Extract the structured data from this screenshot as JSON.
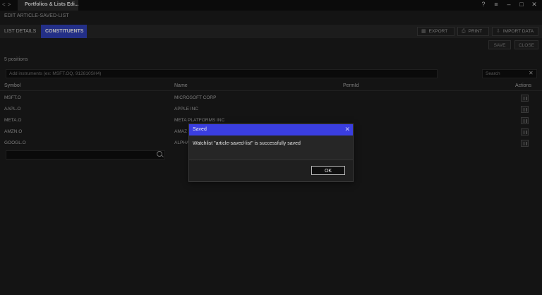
{
  "window": {
    "tab_title": "Portfolios & Lists Edi...",
    "nav": [
      "<",
      ">"
    ],
    "controls": {
      "help": "?",
      "menu": "≡",
      "minimize": "–",
      "maximize": "□",
      "close": "✕"
    }
  },
  "header": {
    "subtitle": "EDIT ARTICLE-SAVED-LIST"
  },
  "tabs": [
    {
      "label": "LIST DETAILS"
    },
    {
      "label": "CONSTITUENTS"
    }
  ],
  "toolbar": {
    "export": "EXPORT",
    "print": "PRINT",
    "import": "IMPORT DATA",
    "save": "SAVE",
    "close": "CLOSE"
  },
  "summary": {
    "positions": "5 positions"
  },
  "inputs": {
    "add_placeholder": "Add instruments (ex: MSFT.OQ, 912810SH4)",
    "search_placeholder": "Search"
  },
  "table": {
    "columns": [
      "Symbol",
      "Name",
      "PermId",
      "Actions"
    ],
    "rows": [
      {
        "symbol": "MSFT.O",
        "name": "MICROSOFT CORP",
        "permid": ""
      },
      {
        "symbol": "AAPL.O",
        "name": "APPLE INC",
        "permid": ""
      },
      {
        "symbol": "META.O",
        "name": "META PLATFORMS INC",
        "permid": ""
      },
      {
        "symbol": "AMZN.O",
        "name": "AMAZ",
        "permid": ""
      },
      {
        "symbol": "GOOGL.O",
        "name": "ALPHA",
        "permid": ""
      }
    ]
  },
  "dialog": {
    "title": "Saved",
    "message": "Watchlist \"article-saved-list\" is successfully saved",
    "ok": "OK",
    "close": "✕"
  },
  "colors": {
    "accent": "#2f3fb4",
    "dialog_header": "#3a3ee0",
    "background": "#1b1b1b"
  }
}
